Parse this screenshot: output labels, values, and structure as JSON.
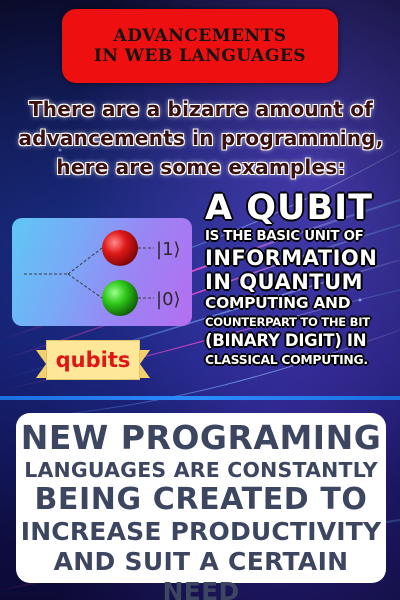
{
  "banner": {
    "line1": "ADVANCEMENTS",
    "line2": "IN WEB LANGUAGES"
  },
  "intro": {
    "line1": "There are a bizarre amount of",
    "line2": "advancements in programming,",
    "line3": "here are some examples:"
  },
  "qubit_card": {
    "state_one_label": "|1⟩",
    "state_zero_label": "|0⟩",
    "ribbon_label": "qubits"
  },
  "qubit_description": {
    "line1": "A QUBIT",
    "line2": "IS THE BASIC UNIT OF",
    "line3": "INFORMATION",
    "line4": "IN QUANTUM",
    "line5": "COMPUTING AND",
    "line6": "COUNTERPART TO THE BIT",
    "line7": "(BINARY DIGIT) IN",
    "line8": "CLASSICAL COMPUTING."
  },
  "bottom": {
    "line1": "NEW PROGRAMING",
    "line2": "LANGUAGES ARE CONSTANTLY",
    "line3": "BEING CREATED TO",
    "line4": "INCREASE PRODUCTIVITY",
    "line5": "AND SUIT A CERTAIN NEED"
  },
  "colors": {
    "banner": "#ee1010",
    "accent_line": "#2c8cff",
    "bottom_text": "#3d4660"
  }
}
